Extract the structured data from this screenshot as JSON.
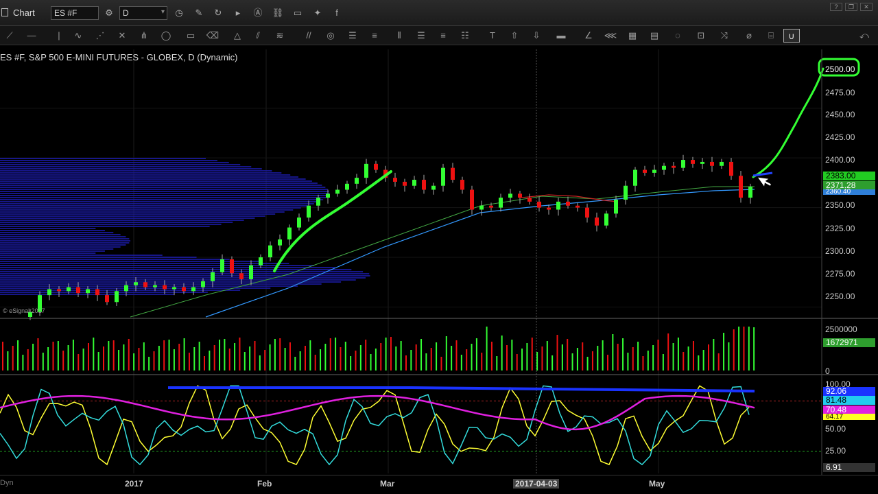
{
  "window": {
    "title": "Chart",
    "symbol_value": "ES #F",
    "interval_value": "D"
  },
  "chart": {
    "title": "ES #F, S&P 500 E-MINI FUTURES - GLOBEX, D (Dynamic)",
    "watermark": "© eSignal 2017"
  },
  "price_axis": {
    "ticks": [
      "2475.00",
      "2450.00",
      "2425.00",
      "2400.00",
      "2350.00",
      "2325.00",
      "2300.00",
      "2275.00",
      "2250.00"
    ],
    "target_label": "2500.00",
    "tags": [
      {
        "value": "2383.00",
        "color": "#22cc22"
      },
      {
        "value": "2371.28",
        "color": "#2e9e2e"
      },
      {
        "value": "2360.40",
        "color": "#2f7fd9"
      }
    ]
  },
  "volume_axis": {
    "ticks": [
      "2500000",
      "0"
    ],
    "tag": {
      "value": "1672971",
      "color": "#2e9e2e"
    }
  },
  "oscillator_axis": {
    "ticks": [
      "100.00",
      "50.00",
      "25.00"
    ],
    "tags": [
      {
        "value": "92.06",
        "color": "#1a33ff"
      },
      {
        "value": "81.48",
        "color": "#22ccee"
      },
      {
        "value": "70.48",
        "color": "#e020e0"
      },
      {
        "value": "64.17",
        "color": "#ffff22"
      }
    ],
    "min_tag": {
      "value": "6.91",
      "color": "#333333"
    }
  },
  "date_axis": {
    "labels": [
      "2017",
      "Feb",
      "Mar",
      "May"
    ],
    "cursor_label": "2017-04-03",
    "dyn_label": "Dyn"
  },
  "colors": {
    "up_candle": "#33ff33",
    "down_candle": "#ee1111",
    "annotation": "#33ff33",
    "ma_fast": "#44aa44",
    "ma_mid": "#cc2222",
    "ma_slow": "#3399ff",
    "profile": "#1a1aa0"
  },
  "chart_data": [
    {
      "type": "candlestick",
      "title": "ES #F, S&P 500 E-MINI FUTURES - GLOBEX, D (Dynamic)",
      "ylim": [
        2240,
        2505
      ],
      "x": [
        "2017",
        "Feb",
        "Mar",
        "2017-04-03",
        "May"
      ],
      "series": [
        {
          "values": [
            2245,
            2262,
            2268,
            2266,
            2270,
            2264,
            2268,
            2262,
            2255,
            2266,
            2272,
            2275,
            2270,
            2272,
            2268,
            2270,
            2266,
            2270,
            2276,
            2285,
            2298,
            2284,
            2278,
            2292,
            2300,
            2312,
            2318,
            2330,
            2340,
            2352,
            2360,
            2364,
            2368,
            2374,
            2380,
            2394,
            2388,
            2380,
            2376,
            2372,
            2378,
            2368,
            2372,
            2390,
            2378,
            2368,
            2348,
            2352,
            2350,
            2360,
            2364,
            2360,
            2356,
            2350,
            2348,
            2356,
            2352,
            2350,
            2340,
            2332,
            2344,
            2358,
            2372,
            2388,
            2385,
            2388,
            2392,
            2390,
            2398,
            2394,
            2396,
            2392,
            2396,
            2382,
            2360,
            2371
          ]
        }
      ]
    },
    {
      "type": "bar",
      "ylim": [
        0,
        2500000
      ],
      "series": [
        {
          "name": "Volume",
          "values": [
            1672971
          ]
        }
      ]
    },
    {
      "type": "line",
      "ylim": [
        0,
        100
      ],
      "series": [
        {
          "values": [
            92.06
          ]
        },
        {
          "values": [
            81.48
          ]
        },
        {
          "values": [
            70.48
          ]
        },
        {
          "values": [
            64.17
          ]
        }
      ]
    }
  ]
}
